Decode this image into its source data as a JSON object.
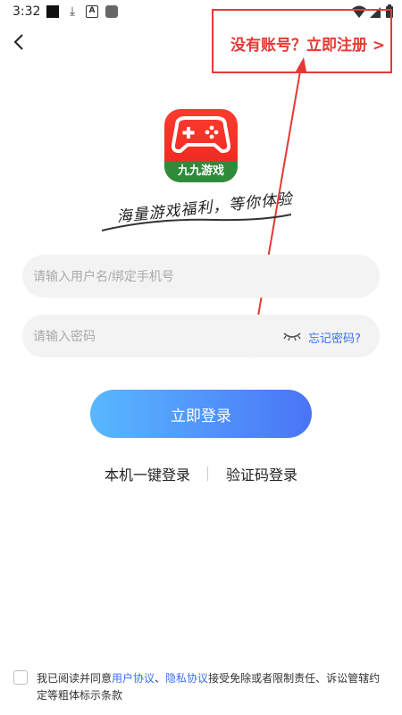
{
  "status_bar": {
    "time": "3:32",
    "icons": [
      "square-notification-icon",
      "download-icon",
      "a-notification-icon",
      "app-notification-icon",
      "wifi-icon",
      "signal-icon",
      "battery-icon"
    ]
  },
  "header": {
    "back_icon": "chevron-left-icon",
    "register_link": "没有账号？立即注册 >"
  },
  "brand": {
    "logo_text": "九九游戏",
    "slogan": "海量游戏福利，等你体验",
    "logo_color": "#ef2d23",
    "logo_band_color": "#2e8b3a"
  },
  "form": {
    "username_placeholder": "请输入用户名/绑定手机号",
    "password_placeholder": "请输入密码",
    "forgot_password": "忘记密码?",
    "login_button": "立即登录",
    "one_click_login": "本机一键登录",
    "sms_login": "验证码登录"
  },
  "agreement": {
    "prefix": "我已阅读并同意",
    "user_agreement": "用户协议",
    "separator": "、",
    "privacy_agreement": "隐私协议",
    "suffix": "接受免除或者限制责任、诉讼管辖约定等粗体标示条款"
  },
  "colors": {
    "accent": "#3a6ff7",
    "button_gradient_start": "#58b8ff",
    "button_gradient_end": "#4a74f6",
    "annotation": "#e53935",
    "input_bg": "#f3f3f3"
  }
}
